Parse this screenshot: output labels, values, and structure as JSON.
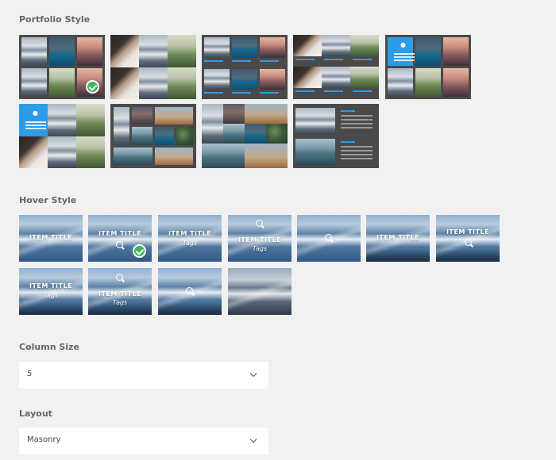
{
  "portfolio_style": {
    "title": "Portfolio Style",
    "selected_index": 0
  },
  "hover_style": {
    "title": "Hover Style",
    "selected_index": 1,
    "items": [
      {
        "title": "ITEM TITLE",
        "tags": ""
      },
      {
        "title": "ITEM TITLE",
        "tags": ""
      },
      {
        "title": "ITEM TITLE",
        "tags": "Tags"
      },
      {
        "title": "ITEM TITLE",
        "tags": "Tags"
      },
      {
        "title": "",
        "tags": ""
      },
      {
        "title": "ITEM TITLE",
        "tags": ""
      },
      {
        "title": "ITEM TITLE",
        "tags": ""
      },
      {
        "title": "ITEM TITLE",
        "tags": "Tags"
      },
      {
        "title": "ITEM TITLE",
        "tags": "Tags"
      },
      {
        "title": "",
        "tags": ""
      },
      {
        "title": "",
        "tags": ""
      }
    ]
  },
  "column_size": {
    "label": "Column Size",
    "value": "5"
  },
  "layout": {
    "label": "Layout",
    "value": "Masonry"
  },
  "colors": {
    "accent": "#2d9be6",
    "selected_check": "#3fb65a",
    "thumb_background": "#4a4a4a",
    "page_background": "#f1f1f1"
  }
}
